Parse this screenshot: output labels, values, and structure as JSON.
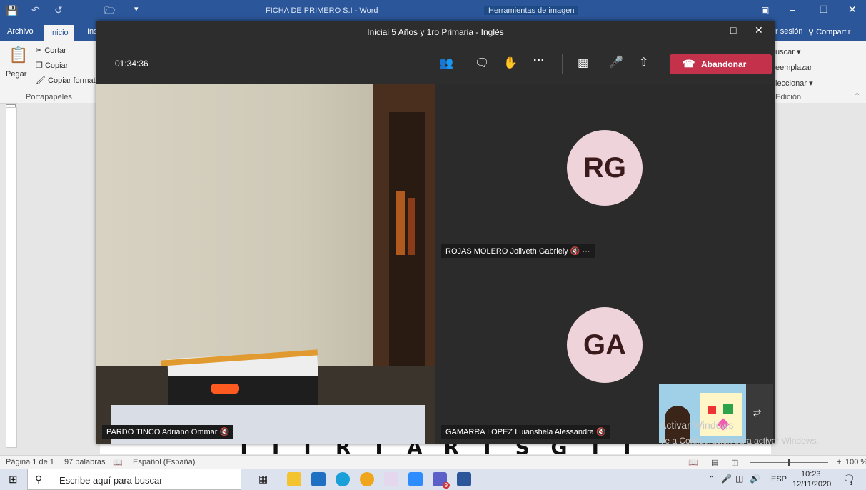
{
  "word": {
    "doc_title": "FICHA DE PRIMERO S.I - Word",
    "tools_context": "Herramientas de imagen",
    "tabs": [
      "Archivo",
      "Inicio",
      "Ins"
    ],
    "right_tabs": {
      "signin": "r sesión",
      "share": "Compartir"
    },
    "clipboard": {
      "paste": "Pegar",
      "cut": "Cortar",
      "copy": "Copiar",
      "format": "Copiar formato",
      "group": "Portapapeles"
    },
    "edit": {
      "find": "uscar",
      "replace": "eemplazar",
      "select": "leccionar",
      "group": "Edición"
    },
    "doc_letters": "T J T R T A R T S G T J",
    "status": {
      "page": "Página 1 de 1",
      "words": "97 palabras",
      "lang": "Español (España)",
      "zoom": "100 %"
    }
  },
  "teams": {
    "window_title": "Inicial 5 Años y 1ro Primaria - Inglés",
    "timer": "01:34:36",
    "leave_label": "Abandonar",
    "participants": [
      {
        "name": "PARDO TINCO Adriano Ommar",
        "initials": ""
      },
      {
        "name": "ROJAS MOLERO Joliveth Gabriely",
        "initials": "RG"
      },
      {
        "name": "GAMARRA LOPEZ Luianshela Alessandra",
        "initials": "GA"
      }
    ]
  },
  "watermark": {
    "line1": "Activar Windows",
    "line2": "Ve a Configuración para activar Windows."
  },
  "taskbar": {
    "search_placeholder": "Escribe aquí para buscar",
    "lang": "ESP",
    "time": "10:23",
    "date": "12/11/2020",
    "teams_badge": "9",
    "notif_count": "1"
  },
  "colors": {
    "word_blue": "#2b579a",
    "teams_dark": "#2d2d2d",
    "leave_red": "#c4314b",
    "avatar_pink": "#eed3db"
  }
}
